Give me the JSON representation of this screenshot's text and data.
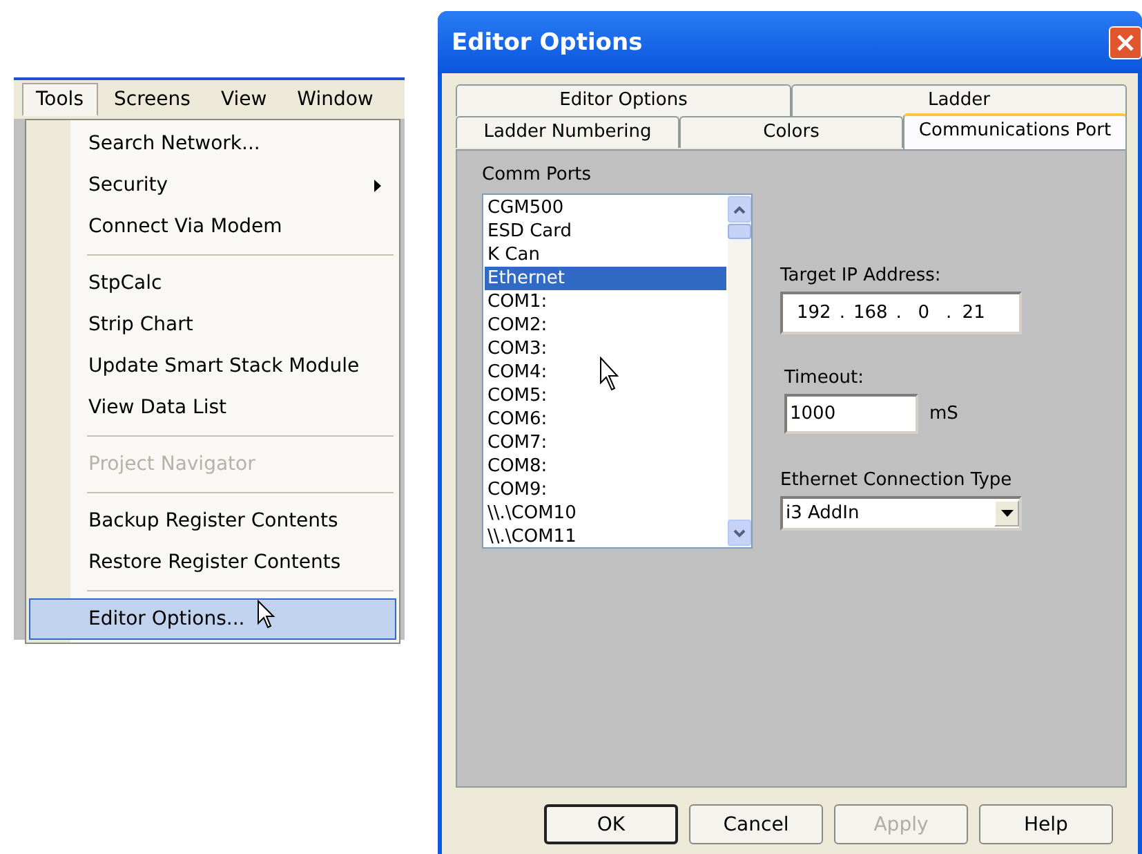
{
  "menu_bar": [
    {
      "label": "Tools",
      "selected": true
    },
    {
      "label": "Screens",
      "selected": false
    },
    {
      "label": "View",
      "selected": false
    },
    {
      "label": "Window",
      "selected": false
    }
  ],
  "menu": [
    {
      "kind": "item",
      "label": "Search Network...",
      "disabled": false,
      "submenu": false,
      "selected": false
    },
    {
      "kind": "item",
      "label": "Security",
      "disabled": false,
      "submenu": true,
      "selected": false
    },
    {
      "kind": "item",
      "label": "Connect Via Modem",
      "disabled": false,
      "submenu": false,
      "selected": false
    },
    {
      "kind": "separator"
    },
    {
      "kind": "item",
      "label": "StpCalc",
      "disabled": false,
      "submenu": false,
      "selected": false
    },
    {
      "kind": "item",
      "label": "Strip Chart",
      "disabled": false,
      "submenu": false,
      "selected": false
    },
    {
      "kind": "item",
      "label": "Update Smart Stack Module",
      "disabled": false,
      "submenu": false,
      "selected": false
    },
    {
      "kind": "item",
      "label": "View Data List",
      "disabled": false,
      "submenu": false,
      "selected": false
    },
    {
      "kind": "separator"
    },
    {
      "kind": "item",
      "label": "Project Navigator",
      "disabled": true,
      "submenu": false,
      "selected": false
    },
    {
      "kind": "separator"
    },
    {
      "kind": "item",
      "label": "Backup Register Contents",
      "disabled": false,
      "submenu": false,
      "selected": false
    },
    {
      "kind": "item",
      "label": "Restore Register Contents",
      "disabled": false,
      "submenu": false,
      "selected": false
    },
    {
      "kind": "separator"
    },
    {
      "kind": "item",
      "label": "Editor Options...",
      "disabled": false,
      "submenu": false,
      "selected": true
    }
  ],
  "dialog": {
    "title": "Editor Options",
    "tab_rows": [
      {
        "tabs": [
          {
            "label": "Editor Options",
            "selected": false
          },
          {
            "label": "Ladder",
            "selected": false
          }
        ]
      },
      {
        "tabs": [
          {
            "label": "Ladder Numbering",
            "selected": false
          },
          {
            "label": "Colors",
            "selected": false
          },
          {
            "label": "Communications Port",
            "selected": true
          }
        ]
      }
    ],
    "comm_ports": {
      "label": "Comm Ports",
      "items": [
        {
          "label": "CGM500",
          "selected": false
        },
        {
          "label": "ESD Card",
          "selected": false
        },
        {
          "label": "K Can",
          "selected": false
        },
        {
          "label": "Ethernet",
          "selected": true
        },
        {
          "label": "COM1:",
          "selected": false
        },
        {
          "label": "COM2:",
          "selected": false
        },
        {
          "label": "COM3:",
          "selected": false
        },
        {
          "label": "COM4:",
          "selected": false
        },
        {
          "label": "COM5:",
          "selected": false
        },
        {
          "label": "COM6:",
          "selected": false
        },
        {
          "label": "COM7:",
          "selected": false
        },
        {
          "label": "COM8:",
          "selected": false
        },
        {
          "label": "COM9:",
          "selected": false
        },
        {
          "label": "\\\\.\\COM10",
          "selected": false
        },
        {
          "label": "\\\\.\\COM11",
          "selected": false
        }
      ]
    },
    "target_ip": {
      "label": "Target IP Address:",
      "octets": [
        "192",
        "168",
        "0",
        "21"
      ],
      "separator": "."
    },
    "timeout": {
      "label": "Timeout:",
      "value": "1000",
      "unit": "mS"
    },
    "connection_type": {
      "label": "Ethernet Connection Type",
      "value": "i3 AddIn"
    },
    "buttons": [
      {
        "label": "OK",
        "default": true,
        "disabled": false
      },
      {
        "label": "Cancel",
        "default": false,
        "disabled": false
      },
      {
        "label": "Apply",
        "default": false,
        "disabled": true
      },
      {
        "label": "Help",
        "default": false,
        "disabled": false
      }
    ]
  }
}
